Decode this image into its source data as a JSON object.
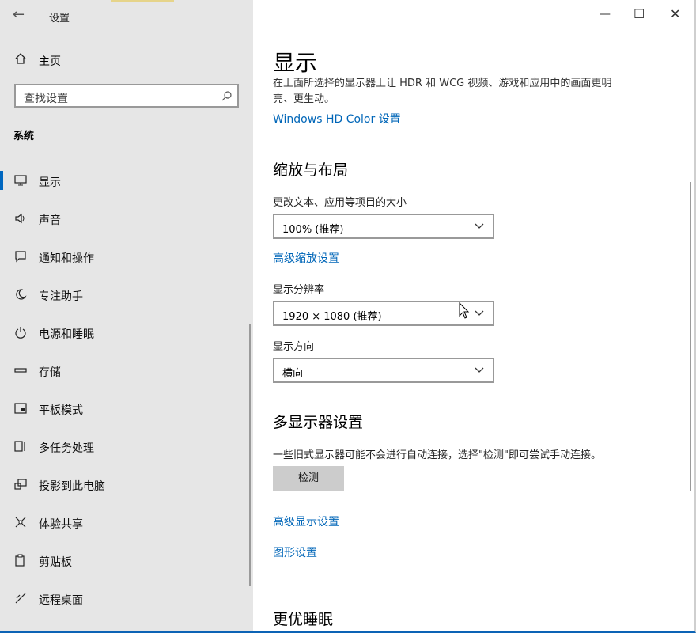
{
  "app": {
    "title": "设置"
  },
  "sidebar": {
    "home_label": "主页",
    "search_placeholder": "查找设置",
    "section_label": "系统",
    "items": [
      {
        "label": "显示",
        "icon": "monitor-icon",
        "active": true
      },
      {
        "label": "声音",
        "icon": "speaker-icon"
      },
      {
        "label": "通知和操作",
        "icon": "notification-icon"
      },
      {
        "label": "专注助手",
        "icon": "moon-icon"
      },
      {
        "label": "电源和睡眠",
        "icon": "power-icon"
      },
      {
        "label": "存储",
        "icon": "storage-icon"
      },
      {
        "label": "平板模式",
        "icon": "tablet-icon"
      },
      {
        "label": "多任务处理",
        "icon": "multitask-icon"
      },
      {
        "label": "投影到此电脑",
        "icon": "project-icon"
      },
      {
        "label": "体验共享",
        "icon": "share-icon"
      },
      {
        "label": "剪贴板",
        "icon": "clipboard-icon"
      },
      {
        "label": "远程桌面",
        "icon": "remote-icon"
      }
    ]
  },
  "main": {
    "title": "显示",
    "description": "在上面所选择的显示器上让 HDR 和 WCG 视频、游戏和应用中的画面更明亮、更生动。",
    "hd_color_link": "Windows HD Color 设置",
    "scale_heading": "缩放与布局",
    "scale_label": "更改文本、应用等项目的大小",
    "scale_value": "100% (推荐)",
    "adv_scale_link": "高级缩放设置",
    "resolution_label": "显示分辨率",
    "resolution_value": "1920 × 1080 (推荐)",
    "orientation_label": "显示方向",
    "orientation_value": "横向",
    "multi_heading": "多显示器设置",
    "multi_desc": "一些旧式显示器可能不会进行自动连接，选择\"检测\"即可尝试手动连接。",
    "detect_button": "检测",
    "adv_display_link": "高级显示设置",
    "graphics_link": "图形设置",
    "sleep_heading": "更优睡眠"
  },
  "colors": {
    "accent": "#0067c0",
    "link": "#0066b8"
  }
}
